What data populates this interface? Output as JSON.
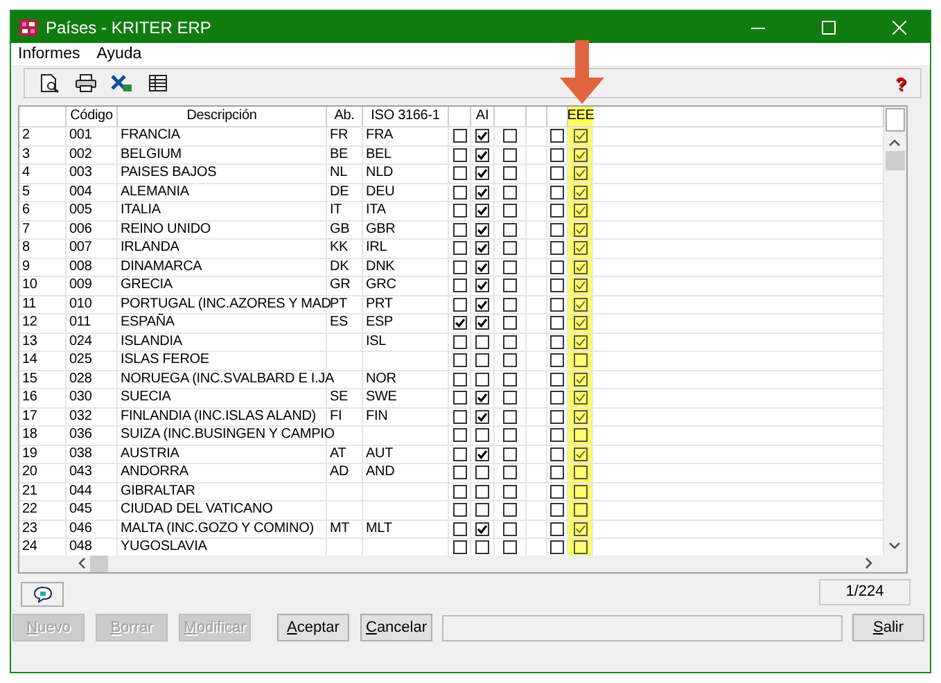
{
  "window": {
    "title": "Países - KRITER ERP"
  },
  "menu": [
    {
      "label": "Informes"
    },
    {
      "label": "Ayuda"
    }
  ],
  "toolbar": {
    "help": "?"
  },
  "table": {
    "columns": [
      {
        "kind": "text"
      },
      {
        "label": "Código",
        "kind": "text"
      },
      {
        "label": "Descripción",
        "kind": "text"
      },
      {
        "label": "Ab.",
        "kind": "text"
      },
      {
        "label": "ISO 3166-1",
        "kind": "text"
      },
      {
        "kind": "check"
      },
      {
        "label": "AI",
        "kind": "check"
      },
      {
        "kind": "check"
      },
      {
        "kind": "blank"
      },
      {
        "kind": "check"
      },
      {
        "label": "EEE",
        "kind": "check",
        "highlighted": true
      }
    ],
    "rows": [
      {
        "cells": [
          "2",
          "001",
          "FRANCIA",
          "FR",
          "FRA"
        ],
        "checks": [
          false,
          true,
          false,
          false,
          true
        ]
      },
      {
        "cells": [
          "3",
          "002",
          "BELGIUM",
          "BE",
          "BEL"
        ],
        "checks": [
          false,
          true,
          false,
          false,
          true
        ]
      },
      {
        "cells": [
          "4",
          "003",
          "PAISES BAJOS",
          "NL",
          "NLD"
        ],
        "checks": [
          false,
          true,
          false,
          false,
          true
        ]
      },
      {
        "cells": [
          "5",
          "004",
          "ALEMANIA",
          "DE",
          "DEU"
        ],
        "checks": [
          false,
          true,
          false,
          false,
          true
        ]
      },
      {
        "cells": [
          "6",
          "005",
          "ITALIA",
          "IT",
          "ITA"
        ],
        "checks": [
          false,
          true,
          false,
          false,
          true
        ]
      },
      {
        "cells": [
          "7",
          "006",
          "REINO UNIDO",
          "GB",
          "GBR"
        ],
        "checks": [
          false,
          true,
          false,
          false,
          true
        ]
      },
      {
        "cells": [
          "8",
          "007",
          "IRLANDA",
          "KK",
          "IRL"
        ],
        "checks": [
          false,
          true,
          false,
          false,
          true
        ]
      },
      {
        "cells": [
          "9",
          "008",
          "DINAMARCA",
          "DK",
          "DNK"
        ],
        "checks": [
          false,
          true,
          false,
          false,
          true
        ]
      },
      {
        "cells": [
          "10",
          "009",
          "GRECIA",
          "GR",
          "GRC"
        ],
        "checks": [
          false,
          true,
          false,
          false,
          true
        ]
      },
      {
        "cells": [
          "11",
          "010",
          "PORTUGAL (INC.AZORES Y MAD",
          "PT",
          "PRT"
        ],
        "checks": [
          false,
          true,
          false,
          false,
          true
        ]
      },
      {
        "cells": [
          "12",
          "011",
          "ESPAÑA",
          "ES",
          "ESP"
        ],
        "checks": [
          true,
          true,
          false,
          false,
          true
        ]
      },
      {
        "cells": [
          "13",
          "024",
          "ISLANDIA",
          null,
          "ISL"
        ],
        "checks": [
          false,
          false,
          false,
          false,
          true
        ]
      },
      {
        "cells": [
          "14",
          "025",
          "ISLAS FEROE",
          null,
          null
        ],
        "checks": [
          false,
          false,
          false,
          false,
          false
        ]
      },
      {
        "cells": [
          "15",
          "028",
          "NORUEGA (INC.SVALBARD E I.JA",
          null,
          "NOR"
        ],
        "checks": [
          false,
          false,
          false,
          false,
          true
        ]
      },
      {
        "cells": [
          "16",
          "030",
          "SUECIA",
          "SE",
          "SWE"
        ],
        "checks": [
          false,
          true,
          false,
          false,
          true
        ]
      },
      {
        "cells": [
          "17",
          "032",
          "FINLANDIA (INC.ISLAS ALAND)",
          "FI",
          "FIN"
        ],
        "checks": [
          false,
          true,
          false,
          false,
          true
        ]
      },
      {
        "cells": [
          "18",
          "036",
          "SUIZA (INC.BUSINGEN Y CAMPIO",
          null,
          null
        ],
        "checks": [
          false,
          false,
          false,
          false,
          false
        ]
      },
      {
        "cells": [
          "19",
          "038",
          "AUSTRIA",
          "AT",
          "AUT"
        ],
        "checks": [
          false,
          true,
          false,
          false,
          true
        ]
      },
      {
        "cells": [
          "20",
          "043",
          "ANDORRA",
          "AD",
          "AND"
        ],
        "checks": [
          false,
          false,
          false,
          false,
          false
        ]
      },
      {
        "cells": [
          "21",
          "044",
          "GIBRALTAR",
          null,
          null
        ],
        "checks": [
          false,
          false,
          false,
          false,
          false
        ]
      },
      {
        "cells": [
          "22",
          "045",
          "CIUDAD DEL VATICANO",
          null,
          null
        ],
        "checks": [
          false,
          false,
          false,
          false,
          false
        ]
      },
      {
        "cells": [
          "23",
          "046",
          "MALTA (INC.GOZO Y COMINO)",
          "MT",
          "MLT"
        ],
        "checks": [
          false,
          true,
          false,
          false,
          true
        ]
      },
      {
        "cells": [
          "24",
          "048",
          "YUGOSLAVIA",
          null,
          null
        ],
        "checks": [
          false,
          false,
          false,
          false,
          false
        ]
      }
    ]
  },
  "record_counter": "1/224",
  "buttons": [
    {
      "label": "Nuevo",
      "disabled": true
    },
    {
      "label": "Borrar",
      "disabled": true
    },
    {
      "label": "Modificar",
      "disabled": true
    },
    {
      "label": "Aceptar",
      "disabled": false
    },
    {
      "label": "Cancelar",
      "disabled": false
    }
  ],
  "exit_button": {
    "label": "Salir",
    "disabled": false
  },
  "annotation": {
    "kind": "arrow"
  }
}
